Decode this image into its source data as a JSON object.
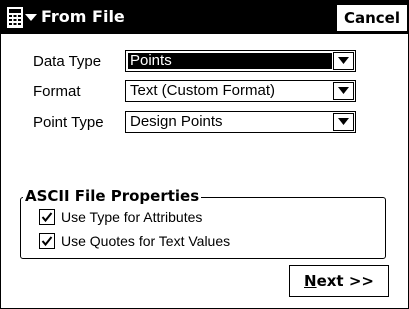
{
  "window": {
    "title": "From File",
    "cancel_label": "Cancel",
    "menu_icon": "start-menu-icon",
    "menu_arrow_icon": "triangle-down-icon"
  },
  "form": {
    "data_type": {
      "label": "Data Type",
      "value": "Points",
      "selected": true
    },
    "format": {
      "label": "Format",
      "value": "Text (Custom Format)"
    },
    "point_type": {
      "label": "Point Type",
      "value": "Design Points"
    }
  },
  "ascii_props": {
    "title": "ASCII File Properties",
    "use_type_for_attributes": {
      "label": "Use Type for Attributes",
      "checked": true
    },
    "use_quotes": {
      "label": "Use Quotes for Text Values",
      "checked": true
    }
  },
  "next_button": {
    "mnemonic": "N",
    "rest": "ext >>"
  },
  "colors": {
    "titlebar_bg": "#000000",
    "selection_bg": "#000000",
    "background": "#ffffff"
  }
}
